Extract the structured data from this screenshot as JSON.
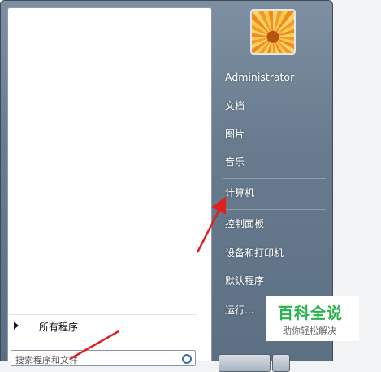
{
  "user": {
    "name": "Administrator"
  },
  "right_menu": {
    "documents": "文档",
    "pictures": "图片",
    "music": "音乐",
    "computer": "计算机",
    "control_panel": "控制面板",
    "devices_printers": "设备和打印机",
    "default_programs": "默认程序",
    "run": "运行..."
  },
  "left_menu": {
    "all_programs": "所有程序"
  },
  "search": {
    "value": "搜索程序和文件"
  },
  "watermark": {
    "title": "百科全说",
    "subtitle": "助你轻松解决"
  },
  "colors": {
    "annotation_arrow": "#e02020",
    "watermark_green": "#2bb24c"
  }
}
